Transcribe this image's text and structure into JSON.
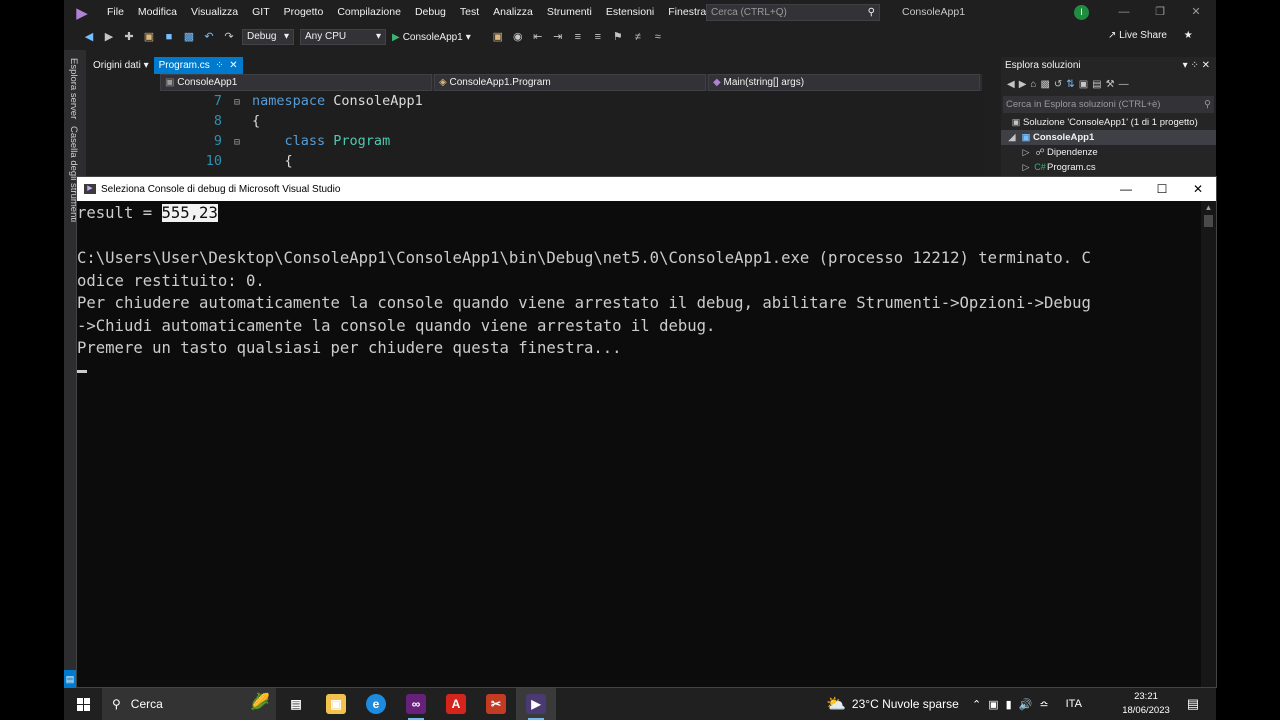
{
  "vs": {
    "menu": [
      "File",
      "Modifica",
      "Visualizza",
      "GIT",
      "Progetto",
      "Compilazione",
      "Debug",
      "Test",
      "Analizza",
      "Strumenti",
      "Estensioni",
      "Finestra",
      "?"
    ],
    "search_placeholder": "Cerca (CTRL+Q)",
    "window_title": "ConsoleApp1",
    "avatar_initial": "I",
    "toolbar": {
      "config": "Debug",
      "platform": "Any CPU",
      "run_label": "ConsoleApp1",
      "live_share": "Live Share"
    },
    "side_tabs": [
      "Esplora server",
      "Casella degli strumenti"
    ],
    "doc_tabs": {
      "origini": "Origini dati",
      "active": "Program.cs"
    },
    "nav": {
      "project": "ConsoleApp1",
      "class": "ConsoleApp1.Program",
      "member": "Main(string[] args)"
    },
    "code": [
      {
        "num": "7",
        "kw": "namespace",
        "name": "ConsoleApp1"
      },
      {
        "num": "8",
        "text": "{"
      },
      {
        "num": "9",
        "kw": "class",
        "name": "Program"
      },
      {
        "num": "10",
        "text": "{"
      }
    ],
    "solution_explorer": {
      "title": "Esplora soluzioni",
      "search": "Cerca in Esplora soluzioni (CTRL+è)",
      "solution": "Soluzione 'ConsoleApp1' (1 di 1 progetto)",
      "project": "ConsoleApp1",
      "deps": "Dipendenze",
      "file": "Program.cs"
    }
  },
  "console": {
    "title": "Seleziona Console di debug di Microsoft Visual Studio",
    "result_label": "result = ",
    "result_value": "555,23",
    "lines": [
      "C:\\Users\\User\\Desktop\\ConsoleApp1\\ConsoleApp1\\bin\\Debug\\net5.0\\ConsoleApp1.exe (processo 12212) terminato. C",
      "odice restituito: 0.",
      "Per chiudere automaticamente la console quando viene arrestato il debug, abilitare Strumenti->Opzioni->Debug",
      "->Chiudi automaticamente la console quando viene arrestato il debug.",
      "Premere un tasto qualsiasi per chiudere questa finestra..."
    ]
  },
  "taskbar": {
    "search": "Cerca",
    "weather": "23°C  Nuvole sparse",
    "lang": "ITA",
    "time": "23:21",
    "date": "18/06/2023"
  }
}
